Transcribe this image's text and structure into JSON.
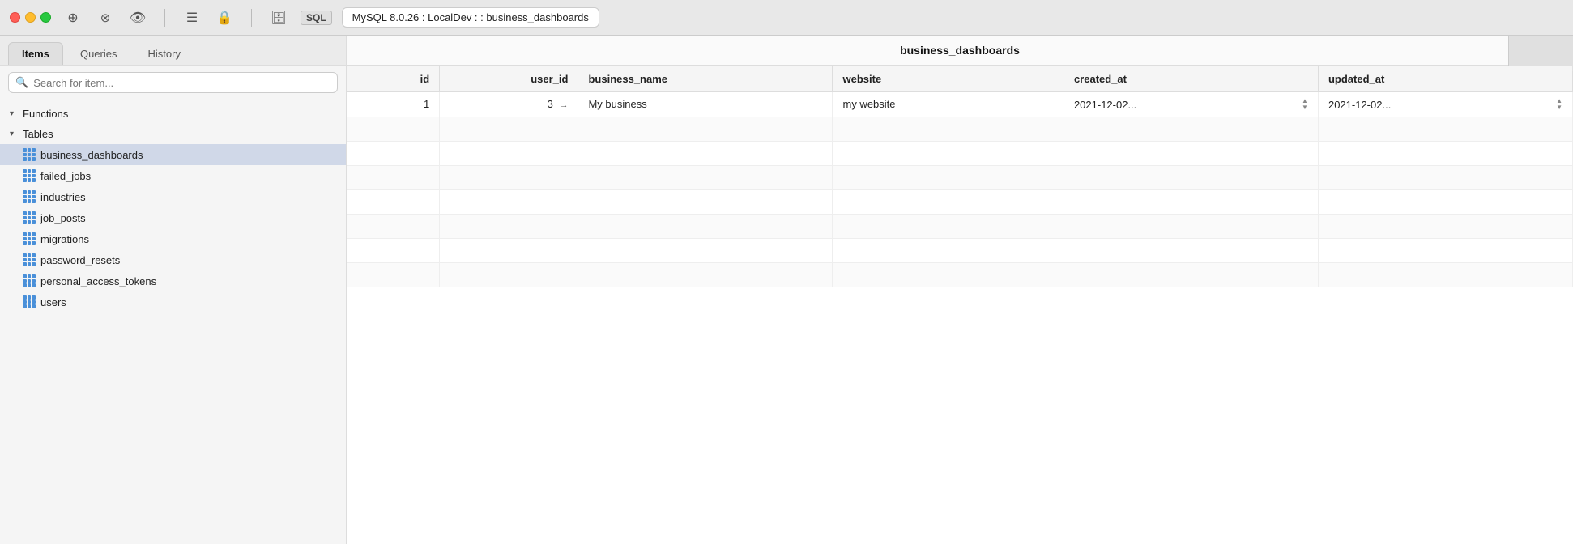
{
  "titlebar": {
    "connection": "MySQL 8.0.26 : LocalDev :  : business_dashboards",
    "sql_label": "SQL"
  },
  "toolbar": {
    "icons": [
      {
        "name": "bookmark-icon",
        "glyph": "⊕"
      },
      {
        "name": "cancel-icon",
        "glyph": "⊗"
      },
      {
        "name": "eye-icon",
        "glyph": "◎"
      },
      {
        "name": "list-icon",
        "glyph": "≡"
      },
      {
        "name": "lock-icon",
        "glyph": "🔒"
      },
      {
        "name": "db-icon",
        "glyph": "🗄"
      }
    ]
  },
  "sidebar": {
    "tabs": [
      {
        "id": "items",
        "label": "Items",
        "active": true
      },
      {
        "id": "queries",
        "label": "Queries",
        "active": false
      },
      {
        "id": "history",
        "label": "History",
        "active": false
      }
    ],
    "search_placeholder": "Search for item...",
    "sections": [
      {
        "id": "functions",
        "label": "Functions",
        "expanded": true,
        "items": []
      },
      {
        "id": "tables",
        "label": "Tables",
        "expanded": true,
        "items": [
          {
            "id": "business_dashboards",
            "label": "business_dashboards",
            "selected": true
          },
          {
            "id": "failed_jobs",
            "label": "failed_jobs",
            "selected": false
          },
          {
            "id": "industries",
            "label": "industries",
            "selected": false
          },
          {
            "id": "job_posts",
            "label": "job_posts",
            "selected": false
          },
          {
            "id": "migrations",
            "label": "migrations",
            "selected": false
          },
          {
            "id": "password_resets",
            "label": "password_resets",
            "selected": false
          },
          {
            "id": "personal_access_tokens",
            "label": "personal_access_tokens",
            "selected": false
          },
          {
            "id": "users",
            "label": "users",
            "selected": false
          }
        ]
      }
    ]
  },
  "content": {
    "table_title": "business_dashboards",
    "columns": [
      {
        "id": "id",
        "label": "id"
      },
      {
        "id": "user_id",
        "label": "user_id"
      },
      {
        "id": "business_name",
        "label": "business_name"
      },
      {
        "id": "website",
        "label": "website"
      },
      {
        "id": "created_at",
        "label": "created_at"
      },
      {
        "id": "updated_at",
        "label": "updated_at"
      }
    ],
    "rows": [
      {
        "id": "1",
        "user_id": "3",
        "user_id_arrow": "→",
        "business_name": "My business",
        "website": "my website",
        "created_at": "2021-12-02...",
        "updated_at": "2021-12-02..."
      }
    ]
  }
}
